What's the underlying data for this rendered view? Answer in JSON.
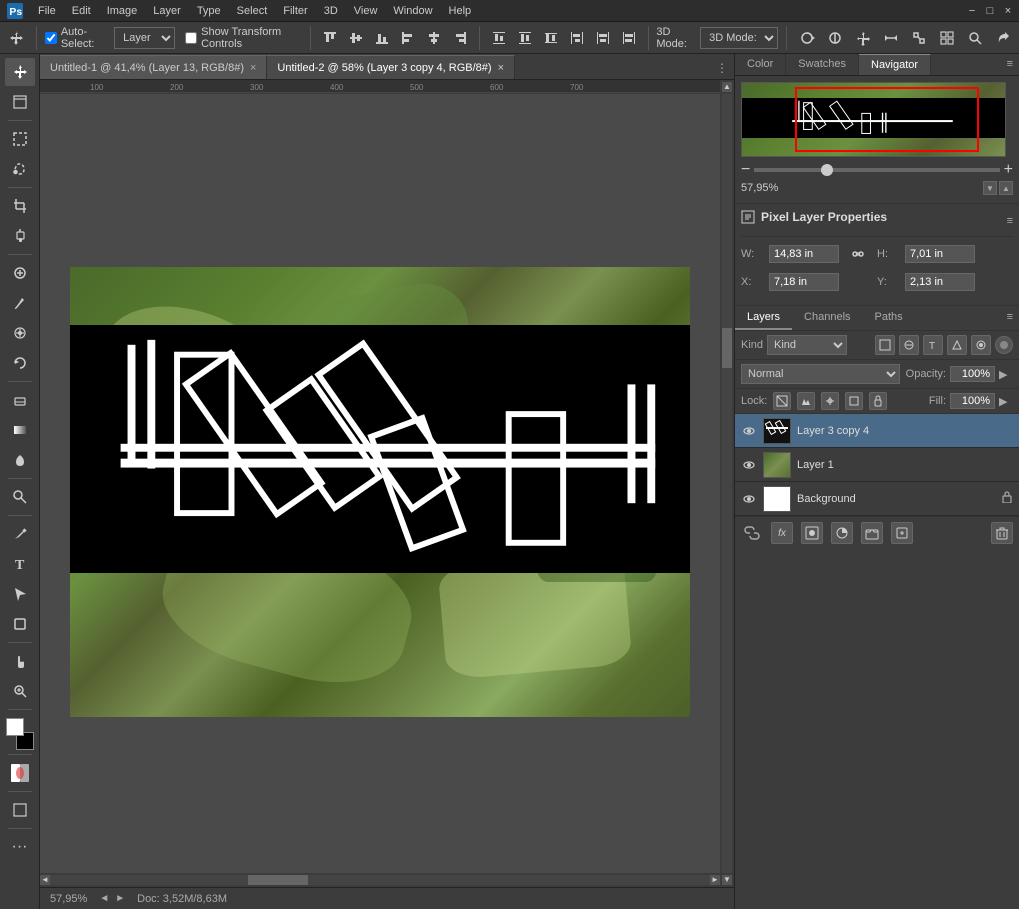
{
  "app": {
    "title": "Adobe Photoshop"
  },
  "menubar": {
    "logo_icon": "ps-icon",
    "items": [
      "File",
      "Edit",
      "Image",
      "Layer",
      "Type",
      "Select",
      "Filter",
      "3D",
      "View",
      "Window",
      "Help"
    ]
  },
  "toolbar": {
    "move_tool": "move-tool",
    "auto_select_label": "Auto-Select:",
    "auto_select_value": "Layer",
    "show_transform": "Show Transform Controls",
    "align_icons": [
      "align-top",
      "align-vert-center",
      "align-bottom",
      "align-left",
      "align-horiz-center",
      "align-right"
    ],
    "distribute_icons": [
      "dist-top",
      "dist-vert",
      "dist-bottom",
      "dist-left",
      "dist-horiz",
      "dist-right"
    ],
    "more_icons": [
      "extra1",
      "extra2",
      "extra3"
    ],
    "three_d_label": "3D Mode:",
    "view_icons": [
      "rotate",
      "roll",
      "pan",
      "slide",
      "scale"
    ]
  },
  "tabs": [
    {
      "label": "Untitled-1 @ 41,4% (Layer 13, RGB/8#)",
      "active": false,
      "close": "×"
    },
    {
      "label": "Untitled-2 @ 58% (Layer 3 copy 4, RGB/8#)",
      "active": true,
      "close": "×"
    }
  ],
  "canvas": {
    "zoom": "57,95%"
  },
  "statusbar": {
    "zoom": "57,95%",
    "doc_info": "Doc: 3,52M/8,63M"
  },
  "navigator": {
    "zoom_value": "57,95%",
    "zoom_icon_minus": "−",
    "zoom_icon_plus": "+"
  },
  "properties": {
    "title": "Pixel Layer Properties",
    "w_label": "W:",
    "w_value": "14,83 in",
    "h_label": "H:",
    "h_value": "7,01 in",
    "x_label": "X:",
    "x_value": "7,18 in",
    "y_label": "Y:",
    "y_value": "2,13 in",
    "link_icon": "link-chain-icon"
  },
  "panel_tabs": {
    "color": "Color",
    "swatches": "Swatches",
    "navigator": "Navigator"
  },
  "layers": {
    "tab_layers": "Layers",
    "tab_channels": "Channels",
    "tab_paths": "Paths",
    "filter_label": "Kind",
    "blend_mode": "Normal",
    "opacity_label": "Opacity:",
    "opacity_value": "100%",
    "lock_label": "Lock:",
    "fill_label": "Fill:",
    "fill_value": "100%",
    "items": [
      {
        "name": "Layer 3 copy 4",
        "visible": true,
        "active": true,
        "thumb_type": "black"
      },
      {
        "name": "Layer 1",
        "visible": true,
        "active": false,
        "thumb_type": "satellite"
      },
      {
        "name": "Background",
        "visible": true,
        "active": false,
        "thumb_type": "white",
        "locked": true
      }
    ],
    "bottom_buttons": [
      "link-icon",
      "fx-icon",
      "mask-icon",
      "adjustment-icon",
      "group-icon",
      "new-layer-icon",
      "delete-icon"
    ]
  },
  "tools": [
    {
      "name": "move-tool",
      "icon": "⊹",
      "active": true
    },
    {
      "name": "artboard-tool",
      "icon": "⬚"
    },
    {
      "sep1": true
    },
    {
      "name": "rect-select-tool",
      "icon": "▭"
    },
    {
      "name": "lasso-tool",
      "icon": "⌒"
    },
    {
      "sep2": true
    },
    {
      "name": "crop-tool",
      "icon": "⊡"
    },
    {
      "name": "eyedropper-tool",
      "icon": "🖋"
    },
    {
      "sep3": true
    },
    {
      "name": "spot-heal-tool",
      "icon": "✚"
    },
    {
      "name": "brush-tool",
      "icon": "✏"
    },
    {
      "name": "clone-tool",
      "icon": "⊕"
    },
    {
      "name": "history-brush-tool",
      "icon": "↺"
    },
    {
      "sep4": true
    },
    {
      "name": "eraser-tool",
      "icon": "◻"
    },
    {
      "name": "gradient-tool",
      "icon": "◼"
    },
    {
      "name": "blur-tool",
      "icon": "💧"
    },
    {
      "sep5": true
    },
    {
      "name": "dodge-tool",
      "icon": "○"
    },
    {
      "sep6": true
    },
    {
      "name": "pen-tool",
      "icon": "✒"
    },
    {
      "name": "type-tool",
      "icon": "T"
    },
    {
      "name": "path-tool",
      "icon": "◁"
    },
    {
      "name": "shape-tool",
      "icon": "□"
    },
    {
      "sep7": true
    },
    {
      "name": "hand-tool",
      "icon": "✋"
    },
    {
      "name": "zoom-tool",
      "icon": "🔍"
    },
    {
      "sep8": true
    },
    {
      "name": "more-tools",
      "icon": "…"
    }
  ]
}
